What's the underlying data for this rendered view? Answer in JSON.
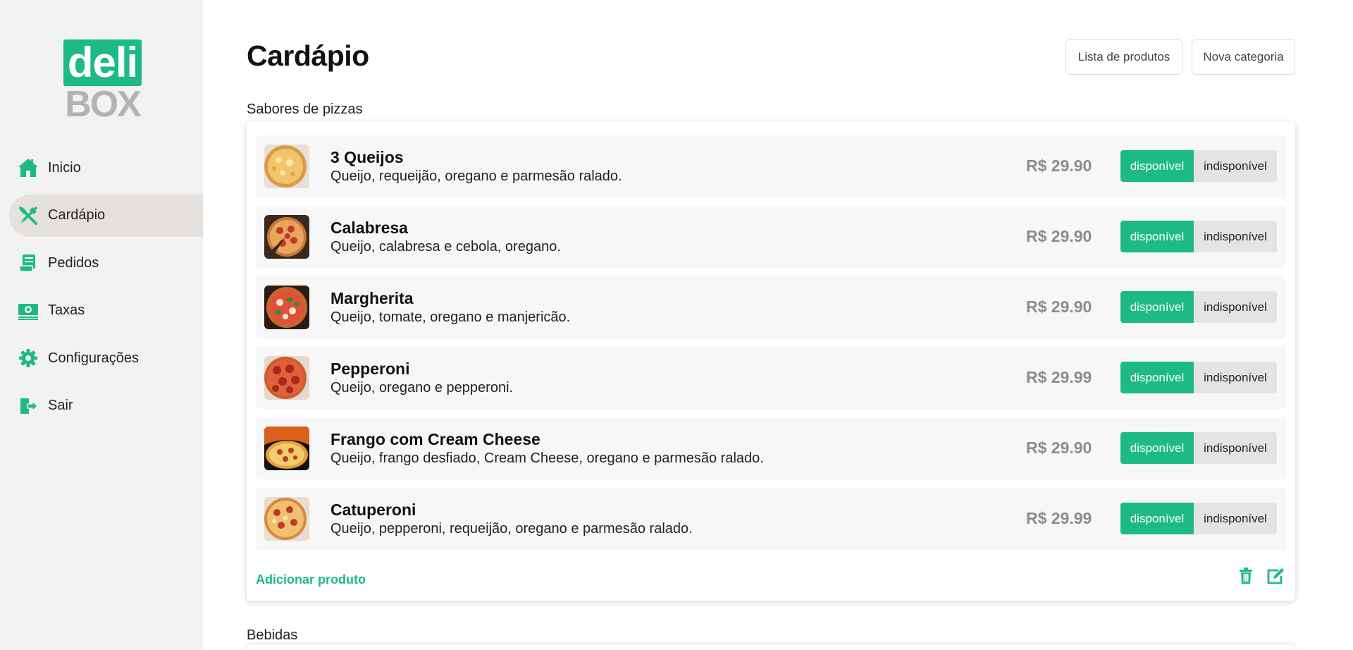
{
  "logo": {
    "top": "deli",
    "bottom": "BOX"
  },
  "sidebar": {
    "items": [
      {
        "label": "Inicio",
        "icon": "home-icon",
        "active": false
      },
      {
        "label": "Cardápio",
        "icon": "utensils-icon",
        "active": true
      },
      {
        "label": "Pedidos",
        "icon": "receipt-icon",
        "active": false
      },
      {
        "label": "Taxas",
        "icon": "money-icon",
        "active": false
      },
      {
        "label": "Configurações",
        "icon": "gear-icon",
        "active": false
      },
      {
        "label": "Sair",
        "icon": "logout-icon",
        "active": false
      }
    ]
  },
  "header": {
    "title": "Cardápio",
    "list_products_label": "Lista de produtos",
    "new_category_label": "Nova categoria"
  },
  "categories": [
    {
      "title": "Sabores de pizzas",
      "add_product_label": "Adicionar produto",
      "products": [
        {
          "name": "3 Queijos",
          "description": "Queijo, requeijão, oregano e parmesão ralado.",
          "price": "R$ 29.90",
          "available_label": "disponível",
          "unavailable_label": "indisponível"
        },
        {
          "name": "Calabresa",
          "description": "Queijo, calabresa e cebola, oregano.",
          "price": "R$ 29.90",
          "available_label": "disponível",
          "unavailable_label": "indisponível"
        },
        {
          "name": "Margherita",
          "description": "Queijo, tomate, oregano e manjericão.",
          "price": "R$ 29.90",
          "available_label": "disponível",
          "unavailable_label": "indisponível"
        },
        {
          "name": "Pepperoni",
          "description": "Queijo, oregano e pepperoni.",
          "price": "R$ 29.99",
          "available_label": "disponível",
          "unavailable_label": "indisponível"
        },
        {
          "name": "Frango com Cream Cheese",
          "description": "Queijo, frango desfiado, Cream Cheese, oregano e parmesão ralado.",
          "price": "R$ 29.90",
          "available_label": "disponível",
          "unavailable_label": "indisponível"
        },
        {
          "name": "Catuperoni",
          "description": "Queijo, pepperoni, requeijão, oregano e parmesão ralado.",
          "price": "R$ 29.99",
          "available_label": "disponível",
          "unavailable_label": "indisponível"
        }
      ]
    },
    {
      "title": "Bebidas"
    }
  ],
  "colors": {
    "accent": "#1dba84",
    "sidebar_bg": "#f2f2f2",
    "active_item_bg": "#e4e1df",
    "row_bg": "#f7f7f7",
    "price": "#8c8c8c"
  }
}
